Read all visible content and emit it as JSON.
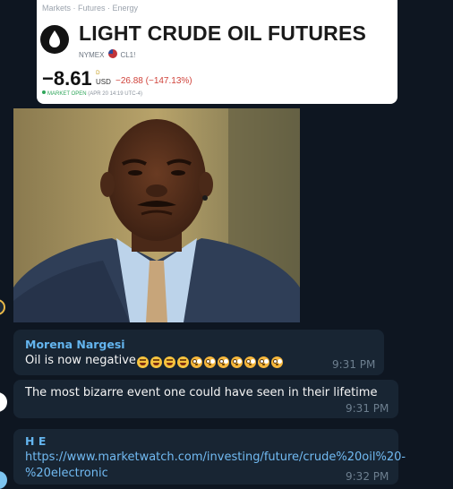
{
  "card": {
    "breadcrumb": "Markets · Futures · Energy",
    "title": "LIGHT CRUDE OIL FUTURES",
    "exchange": "NYMEX",
    "ticker": "CL1!",
    "price": "−8.61",
    "price_superscript": "D",
    "unit": "USD",
    "change": "−26.88 (−147.13%)",
    "market_status": "MARKET OPEN",
    "market_time": "(APR 20 14:19 UTC-4)",
    "colors": {
      "change": "#d0433b",
      "open": "#2fa65a"
    }
  },
  "messages": [
    {
      "sender": "Morena Nargesi",
      "text": "Oil is now negative",
      "emojis": [
        "rofl-icon",
        "rofl-icon",
        "rofl-icon",
        "rofl-icon",
        "flushed-icon",
        "flushed-icon",
        "flushed-icon",
        "flushed-icon",
        "flushed-icon",
        "flushed-icon",
        "flushed-icon"
      ],
      "time": "9:31 PM"
    },
    {
      "text": "The most bizarre event one could have seen in their lifetime",
      "time": "9:31 PM"
    },
    {
      "sender": "H E",
      "link_line1": "https://www.marketwatch.com/investing/future/crude%20oil%20-",
      "link_line2": "%20electronic",
      "time": "9:32 PM"
    }
  ],
  "colors": {
    "background": "#0e1621",
    "bubble": "#182533",
    "sender": "#64b5ef",
    "link": "#71baf2",
    "time": "#6d7f8f"
  }
}
